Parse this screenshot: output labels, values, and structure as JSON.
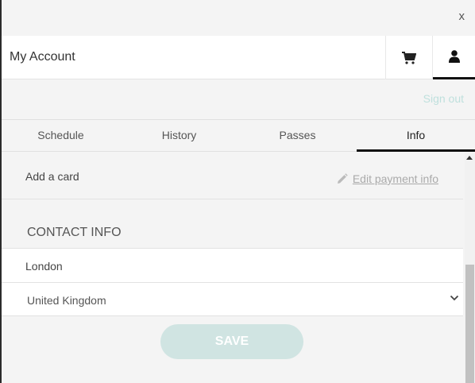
{
  "window": {
    "close_label": "x"
  },
  "header": {
    "title": "My Account",
    "cart_icon": "cart-icon",
    "user_icon": "user-icon"
  },
  "signout_label": "Sign out",
  "tabs": [
    {
      "label": "Schedule"
    },
    {
      "label": "History"
    },
    {
      "label": "Passes"
    },
    {
      "label": "Info",
      "active": true
    }
  ],
  "payment": {
    "add_card_label": "Add a card",
    "edit_label": "Edit payment info"
  },
  "contact": {
    "heading": "CONTACT INFO",
    "city_value": "London",
    "country_value": "United Kingdom"
  },
  "save_label": "SAVE",
  "colors": {
    "accent_light": "#bfe0dd",
    "save_bg": "#d0e4e2"
  }
}
